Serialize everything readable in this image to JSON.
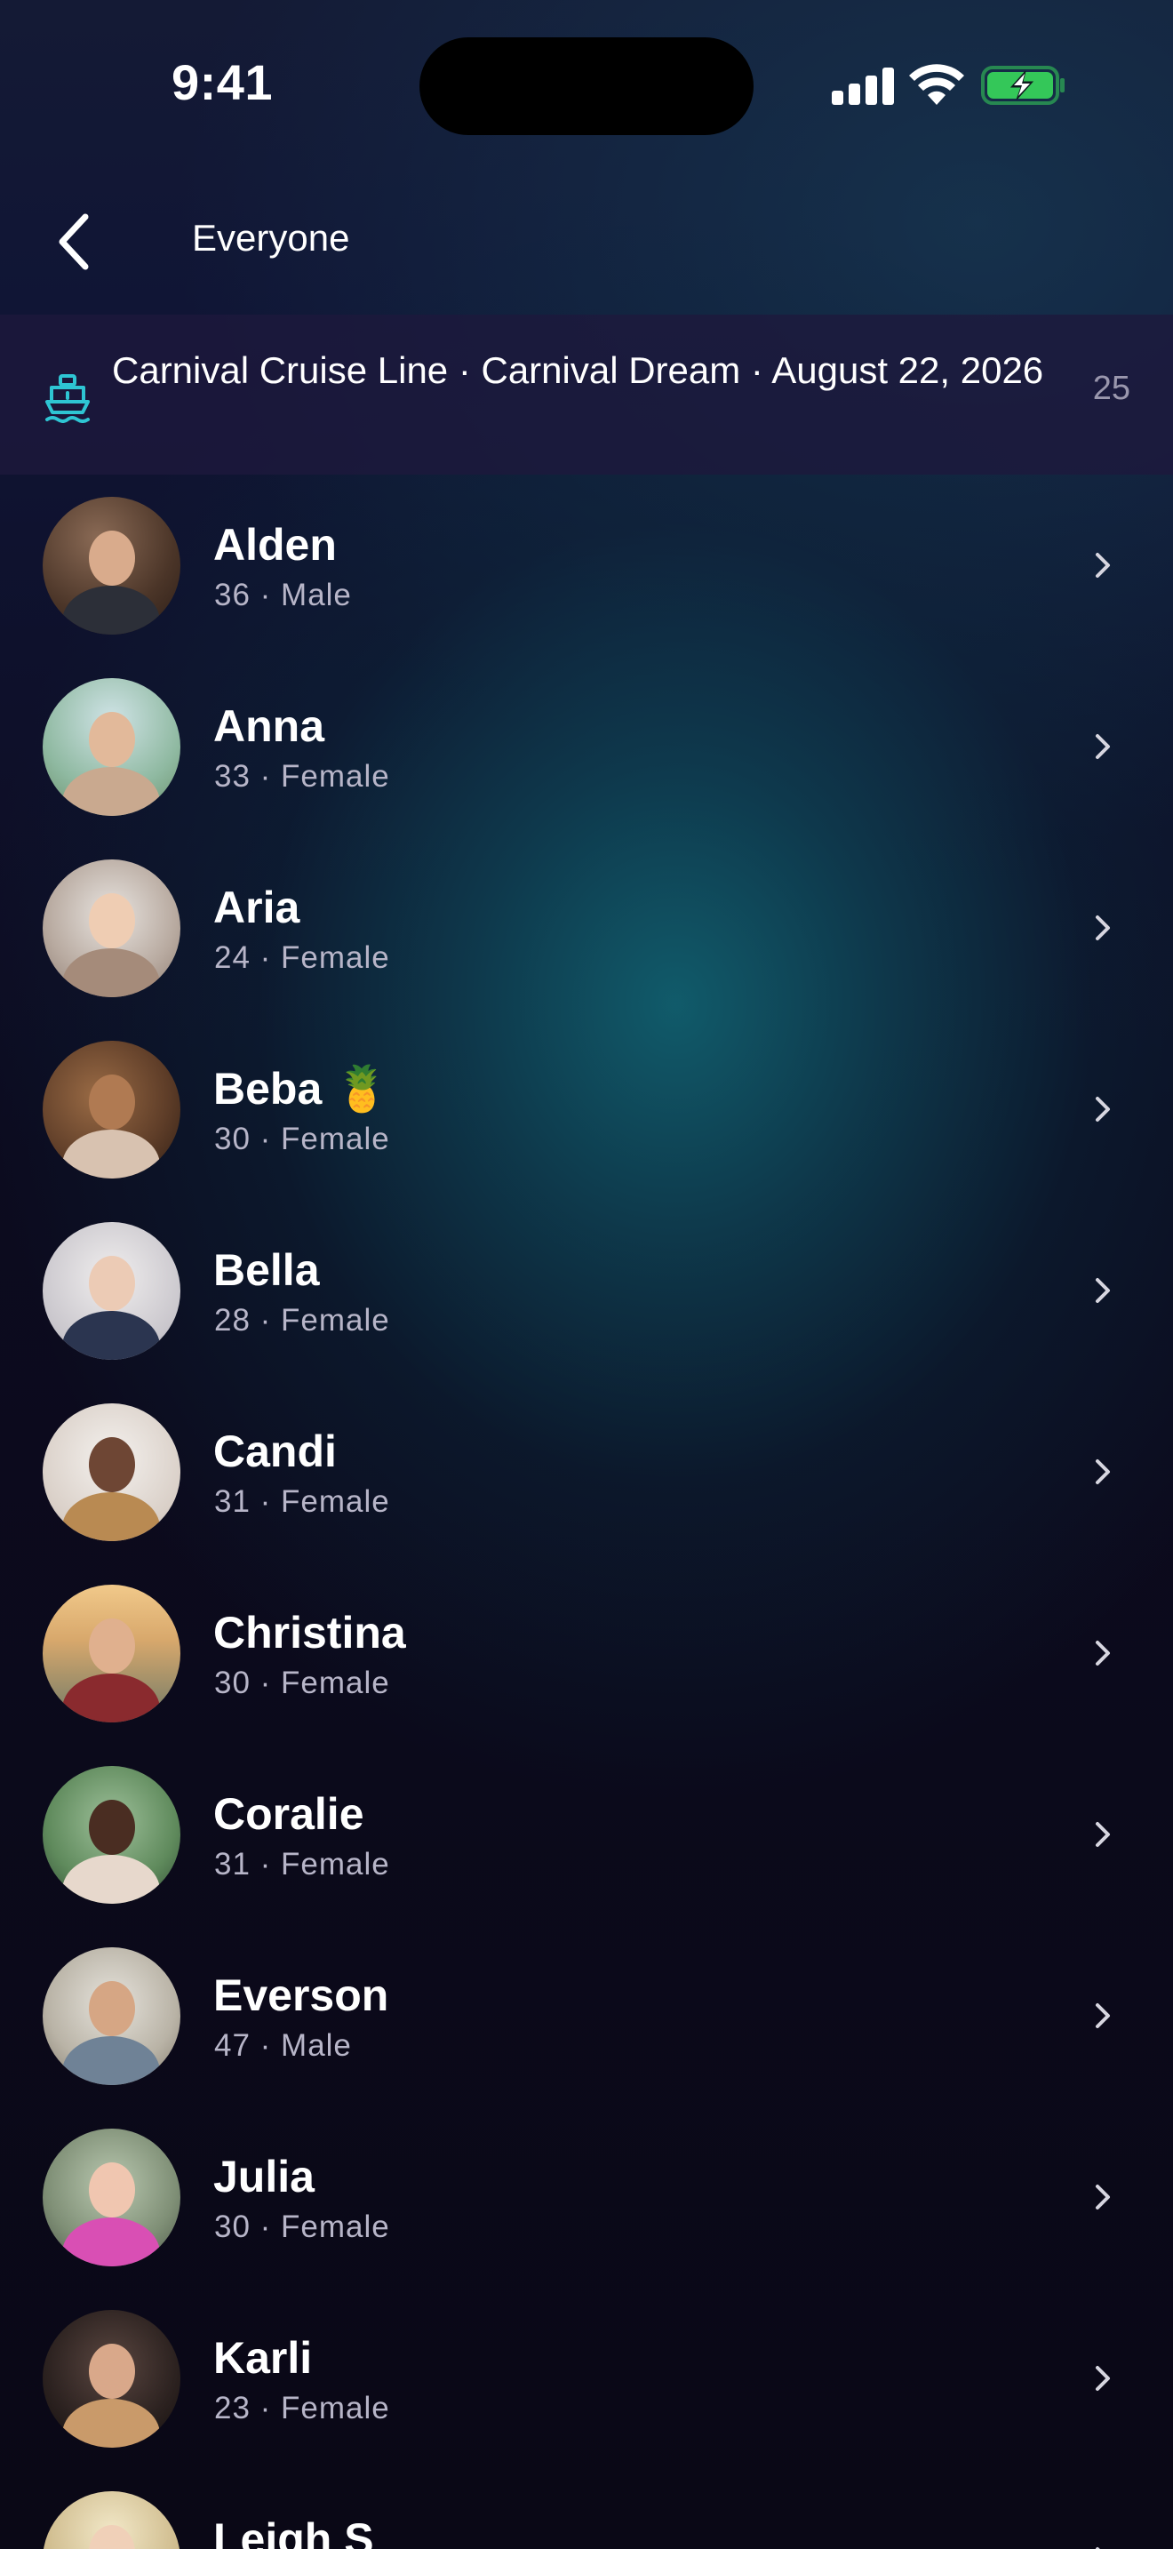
{
  "status_bar": {
    "time": "9:41"
  },
  "nav": {
    "title": "Everyone",
    "back_icon": "chevron-left-icon"
  },
  "trip": {
    "icon": "ship-icon",
    "label": "Carnival Cruise Line · Carnival Dream · August 22, 2026",
    "count": "25"
  },
  "people": [
    {
      "name": "Alden",
      "meta": "36 · Male"
    },
    {
      "name": "Anna",
      "meta": "33 · Female"
    },
    {
      "name": "Aria",
      "meta": "24 · Female"
    },
    {
      "name": "Beba 🍍",
      "meta": "30 · Female"
    },
    {
      "name": "Bella",
      "meta": "28 · Female"
    },
    {
      "name": "Candi",
      "meta": "31 · Female"
    },
    {
      "name": "Christina",
      "meta": "30 · Female"
    },
    {
      "name": "Coralie",
      "meta": "31 · Female"
    },
    {
      "name": "Everson",
      "meta": "47 · Male"
    },
    {
      "name": "Julia",
      "meta": "30 · Female"
    },
    {
      "name": "Karli",
      "meta": "23 · Female"
    },
    {
      "name": "Leigh S",
      "meta": ""
    }
  ],
  "colors": {
    "accent_teal": "#2ec5d3",
    "battery_green": "#34c759",
    "meta_text": "#b7b5c8",
    "banner_bg": "#1e183c"
  }
}
